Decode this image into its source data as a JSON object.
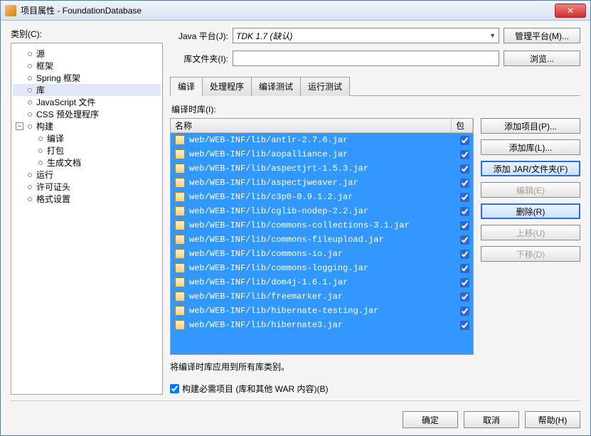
{
  "title": "项目属性 - FoundationDatabase",
  "left": {
    "label": "类别(C):",
    "tree": [
      {
        "t": "源",
        "d": 1
      },
      {
        "t": "框架",
        "d": 1
      },
      {
        "t": "Spring 框架",
        "d": 1
      },
      {
        "t": "库",
        "d": 1,
        "sel": true
      },
      {
        "t": "JavaScript 文件",
        "d": 1
      },
      {
        "t": "CSS 预处理程序",
        "d": 1
      },
      {
        "t": "构建",
        "d": 1,
        "expand": true
      },
      {
        "t": "编译",
        "d": 2
      },
      {
        "t": "打包",
        "d": 2
      },
      {
        "t": "生成文档",
        "d": 2
      },
      {
        "t": "运行",
        "d": 1
      },
      {
        "t": "许可证头",
        "d": 1
      },
      {
        "t": "格式设置",
        "d": 1
      }
    ]
  },
  "form": {
    "java_label": "Java 平台(J):",
    "java_value": "TDK 1.7 (缺认)",
    "manage_btn": "管理平台(M)...",
    "libdir_label": "库文件夹(I):",
    "libdir_value": "",
    "browse_btn": "浏览..."
  },
  "tabs": [
    "编译",
    "处理程序",
    "编译测试",
    "运行测试"
  ],
  "active_tab": 0,
  "compile": {
    "sub_label": "编译时库(I):",
    "cols": {
      "name": "名称",
      "pkg": "包"
    },
    "rows": [
      "web/WEB-INF/lib/antlr-2.7.6.jar",
      "web/WEB-INF/lib/aopalliance.jar",
      "web/WEB-INF/lib/aspectjrt-1.5.3.jar",
      "web/WEB-INF/lib/aspectjweaver.jar",
      "web/WEB-INF/lib/c3p0-0.9.1.2.jar",
      "web/WEB-INF/lib/cglib-nodep-2.2.jar",
      "web/WEB-INF/lib/commons-collections-3.1.jar",
      "web/WEB-INF/lib/commons-fileupload.jar",
      "web/WEB-INF/lib/commons-io.jar",
      "web/WEB-INF/lib/commons-logging.jar",
      "web/WEB-INF/lib/dom4j-1.6.1.jar",
      "web/WEB-INF/lib/freemarker.jar",
      "web/WEB-INF/lib/hibernate-testing.jar",
      "web/WEB-INF/lib/hibernate3.jar"
    ],
    "note": "将编译时库应用到所有库类别。",
    "buttons": {
      "add_project": "添加项目(P)...",
      "add_lib": "添加库(L)...",
      "add_jar": "添加 JAR/文件夹(F)",
      "edit": "编辑(E)",
      "remove": "删除(R)",
      "move_up": "上移(U)",
      "move_down": "下移(D)"
    }
  },
  "checkbox": {
    "label": "构建必需项目  (库和其他 WAR 内容)(B)",
    "checked": true
  },
  "footer": {
    "ok": "确定",
    "cancel": "取消",
    "help": "帮助(H)"
  }
}
